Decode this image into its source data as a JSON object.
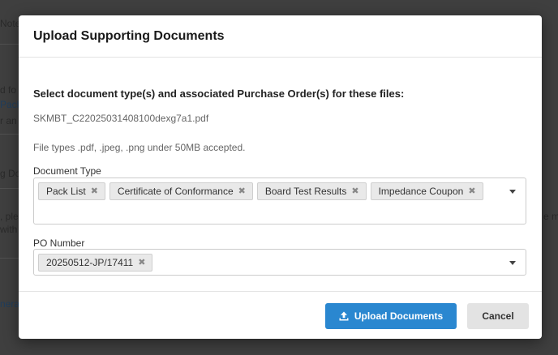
{
  "background": {
    "fragments": [
      {
        "text": "Note",
        "cls": ""
      },
      {
        "text": "d fo",
        "cls": ""
      },
      {
        "text": "Pack",
        "cls": "blue"
      },
      {
        "text": "r an",
        "cls": ""
      },
      {
        "text": "g Do",
        "cls": ""
      },
      {
        "text": ", ple",
        "cls": ""
      },
      {
        "text": "with",
        "cls": ""
      },
      {
        "text": "e ma",
        "cls": ""
      },
      {
        "text": "nera",
        "cls": "blue"
      }
    ]
  },
  "modal": {
    "title": "Upload Supporting Documents",
    "instructions": "Select document type(s) and associated Purchase Order(s) for these files:",
    "filename": "SKMBT_C22025031408100dexg7a1.pdf",
    "file_types_note": "File types .pdf, .jpeg, .png under 50MB accepted.",
    "document_type": {
      "label": "Document Type",
      "selected": [
        "Pack List",
        "Certificate of Conformance",
        "Board Test Results",
        "Impedance Coupon"
      ]
    },
    "po_number": {
      "label": "PO Number",
      "selected": [
        "20250512-JP/17411"
      ]
    },
    "footer": {
      "upload_label": "Upload Documents",
      "cancel_label": "Cancel"
    }
  },
  "colors": {
    "primary": "#2a87d0",
    "cancel": "#e3e3e3"
  }
}
